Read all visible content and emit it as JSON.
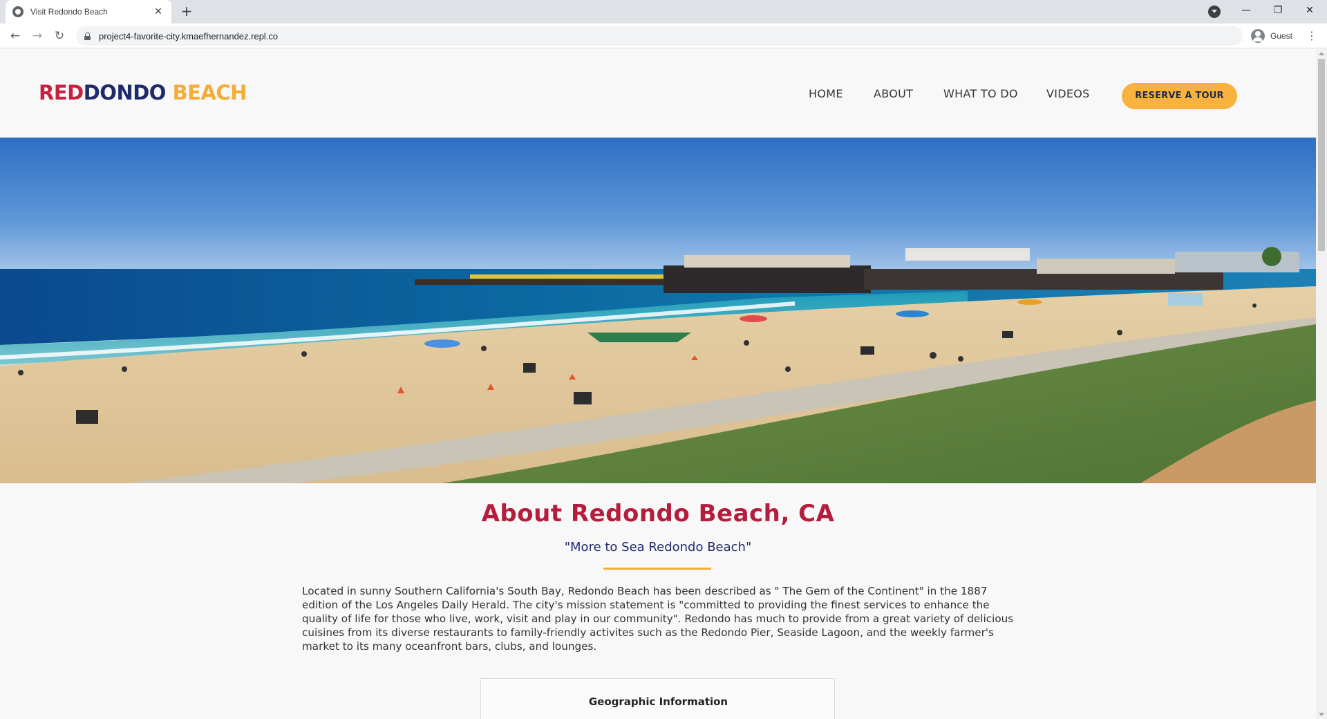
{
  "browser": {
    "tab_title": "Visit Redondo Beach",
    "tab_close": "✕",
    "new_tab": "+",
    "url": "project4-favorite-city.kmaefhernandez.repl.co",
    "profile_label": "Guest",
    "back": "←",
    "forward": "→",
    "reload": "↻",
    "menu": "⋮",
    "minimize": "—",
    "restore": "❐",
    "close": "✕"
  },
  "site": {
    "logo": {
      "part1": "RED",
      "part2": "ONDO",
      "part3": "BEACH",
      "d_letter": "D"
    },
    "nav": [
      "HOME",
      "ABOUT",
      "WHAT TO DO",
      "VIDEOS"
    ],
    "cta_label": "RESERVE A TOUR"
  },
  "about": {
    "title": "About Redondo Beach, CA",
    "subtitle": "\"More to Sea Redondo Beach\"",
    "body": "Located in sunny Southern California's South Bay, Redondo Beach has been described as \" The Gem of the Continent\" in the 1887 edition of the Los Angeles Daily Herald. The city's mission statement is \"committed to providing the finest services to enhance the quality of life for those who live, work, visit and play in our community\". Redondo has much to provide from a great variety of delicious cuisines from its diverse restaurants to family-friendly activites such as the Redondo Pier, Seaside Lagoon, and the weekly farmer's market to its many oceanfront bars, clubs, and lounges.",
    "geo_title": "Geographic Information"
  },
  "colors": {
    "brand_red": "#c8213f",
    "brand_navy": "#1f2a6b",
    "brand_yellow": "#f3ad37"
  }
}
